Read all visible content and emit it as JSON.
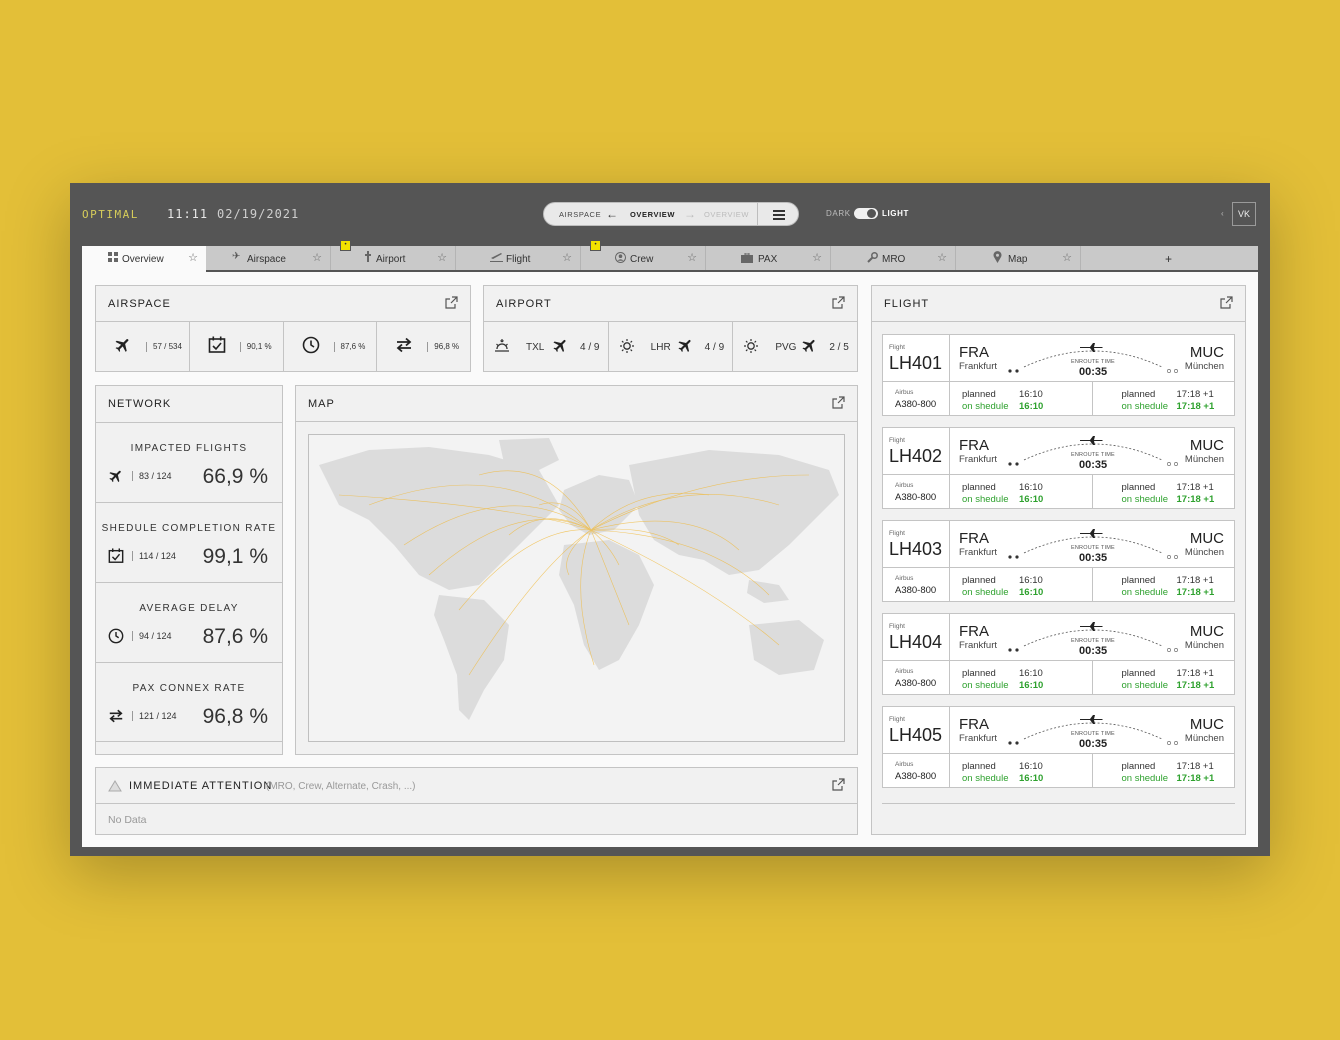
{
  "header": {
    "brand": "OPTIMAL",
    "time": "11:11",
    "date": "02/19/2021",
    "breadcrumb": {
      "back": "AIRSPACE",
      "current": "OVERVIEW",
      "forward": "OVERVIEW"
    },
    "theme": {
      "dark": "DARK",
      "light": "LIGHT"
    },
    "user_initials": "VK"
  },
  "tabs": [
    {
      "label": "Overview",
      "icon": "grid-icon"
    },
    {
      "label": "Airspace",
      "icon": "plane-icon"
    },
    {
      "label": "Airport",
      "icon": "tower-icon",
      "badge": "•"
    },
    {
      "label": "Flight",
      "icon": "takeoff-icon"
    },
    {
      "label": "Crew",
      "icon": "user-icon",
      "badge": "•"
    },
    {
      "label": "PAX",
      "icon": "luggage-icon"
    },
    {
      "label": "MRO",
      "icon": "wrench-icon"
    },
    {
      "label": "Map",
      "icon": "pin-icon"
    }
  ],
  "tab_add": "+",
  "airspace": {
    "title": "AIRSPACE",
    "metrics": [
      {
        "icon": "plane-icon",
        "value": "57 / 534"
      },
      {
        "icon": "calendar-check-icon",
        "value": "90,1 %"
      },
      {
        "icon": "clock-icon",
        "value": "87,6 %"
      },
      {
        "icon": "transfer-icon",
        "value": "96,8 %"
      }
    ]
  },
  "airport": {
    "title": "AIRPORT",
    "items": [
      {
        "weather": "sunset-icon",
        "code": "TXL",
        "count": "4 / 9"
      },
      {
        "weather": "sun-icon",
        "code": "LHR",
        "count": "4 / 9"
      },
      {
        "weather": "sun-icon",
        "code": "PVG",
        "count": "2 / 5"
      }
    ]
  },
  "network": {
    "title": "NETWORK",
    "items": [
      {
        "label": "IMPACTED FLIGHTS",
        "icon": "plane-icon",
        "count": "83 / 124",
        "percent": "66,9 %"
      },
      {
        "label": "SHEDULE COMPLETION RATE",
        "icon": "calendar-check-icon",
        "count": "114 / 124",
        "percent": "99,1 %"
      },
      {
        "label": "AVERAGE DELAY",
        "icon": "clock-icon",
        "count": "94 / 124",
        "percent": "87,6 %"
      },
      {
        "label": "PAX CONNEX RATE",
        "icon": "transfer-icon",
        "count": "121 / 124",
        "percent": "96,8 %"
      }
    ]
  },
  "map": {
    "title": "MAP"
  },
  "attention": {
    "title": "IMMEDIATE ATTENTION",
    "subtitle": "(MRO, Crew, Alternate, Crash, ...)",
    "empty": "No Data"
  },
  "flight": {
    "title": "FLIGHT",
    "items": [
      {
        "label": "Flight",
        "number": "LH401",
        "aircraft_label": "Airbus",
        "aircraft": "A380-800",
        "origin": "FRA",
        "origin_city": "Frankfurt",
        "dest": "MUC",
        "dest_city": "München",
        "enroute_label": "ENROUTE TIME",
        "enroute": "00:35",
        "dep_planned_label": "planned",
        "dep_planned": "16:10",
        "dep_status": "on shedule",
        "dep_actual": "16:10",
        "arr_planned_label": "planned",
        "arr_planned": "17:18 +1",
        "arr_status": "on shedule",
        "arr_actual": "17:18 +1"
      },
      {
        "label": "Flight",
        "number": "LH402",
        "aircraft_label": "Airbus",
        "aircraft": "A380-800",
        "origin": "FRA",
        "origin_city": "Frankfurt",
        "dest": "MUC",
        "dest_city": "München",
        "enroute_label": "ENROUTE TIME",
        "enroute": "00:35",
        "dep_planned_label": "planned",
        "dep_planned": "16:10",
        "dep_status": "on shedule",
        "dep_actual": "16:10",
        "arr_planned_label": "planned",
        "arr_planned": "17:18 +1",
        "arr_status": "on shedule",
        "arr_actual": "17:18 +1"
      },
      {
        "label": "Flight",
        "number": "LH403",
        "aircraft_label": "Airbus",
        "aircraft": "A380-800",
        "origin": "FRA",
        "origin_city": "Frankfurt",
        "dest": "MUC",
        "dest_city": "München",
        "enroute_label": "ENROUTE TIME",
        "enroute": "00:35",
        "dep_planned_label": "planned",
        "dep_planned": "16:10",
        "dep_status": "on shedule",
        "dep_actual": "16:10",
        "arr_planned_label": "planned",
        "arr_planned": "17:18 +1",
        "arr_status": "on shedule",
        "arr_actual": "17:18 +1"
      },
      {
        "label": "Flight",
        "number": "LH404",
        "aircraft_label": "Airbus",
        "aircraft": "A380-800",
        "origin": "FRA",
        "origin_city": "Frankfurt",
        "dest": "MUC",
        "dest_city": "München",
        "enroute_label": "ENROUTE TIME",
        "enroute": "00:35",
        "dep_planned_label": "planned",
        "dep_planned": "16:10",
        "dep_status": "on shedule",
        "dep_actual": "16:10",
        "arr_planned_label": "planned",
        "arr_planned": "17:18 +1",
        "arr_status": "on shedule",
        "arr_actual": "17:18 +1"
      },
      {
        "label": "Flight",
        "number": "LH405",
        "aircraft_label": "Airbus",
        "aircraft": "A380-800",
        "origin": "FRA",
        "origin_city": "Frankfurt",
        "dest": "MUC",
        "dest_city": "München",
        "enroute_label": "ENROUTE TIME",
        "enroute": "00:35",
        "dep_planned_label": "planned",
        "dep_planned": "16:10",
        "dep_status": "on shedule",
        "dep_actual": "16:10",
        "arr_planned_label": "planned",
        "arr_planned": "17:18 +1",
        "arr_status": "on shedule",
        "arr_actual": "17:18 +1"
      }
    ]
  },
  "colors": {
    "background": "#e3bf38",
    "frame": "#555555",
    "badge": "#f2e200",
    "on_schedule": "#2ea12e",
    "route_lines": "#f0b93a"
  }
}
